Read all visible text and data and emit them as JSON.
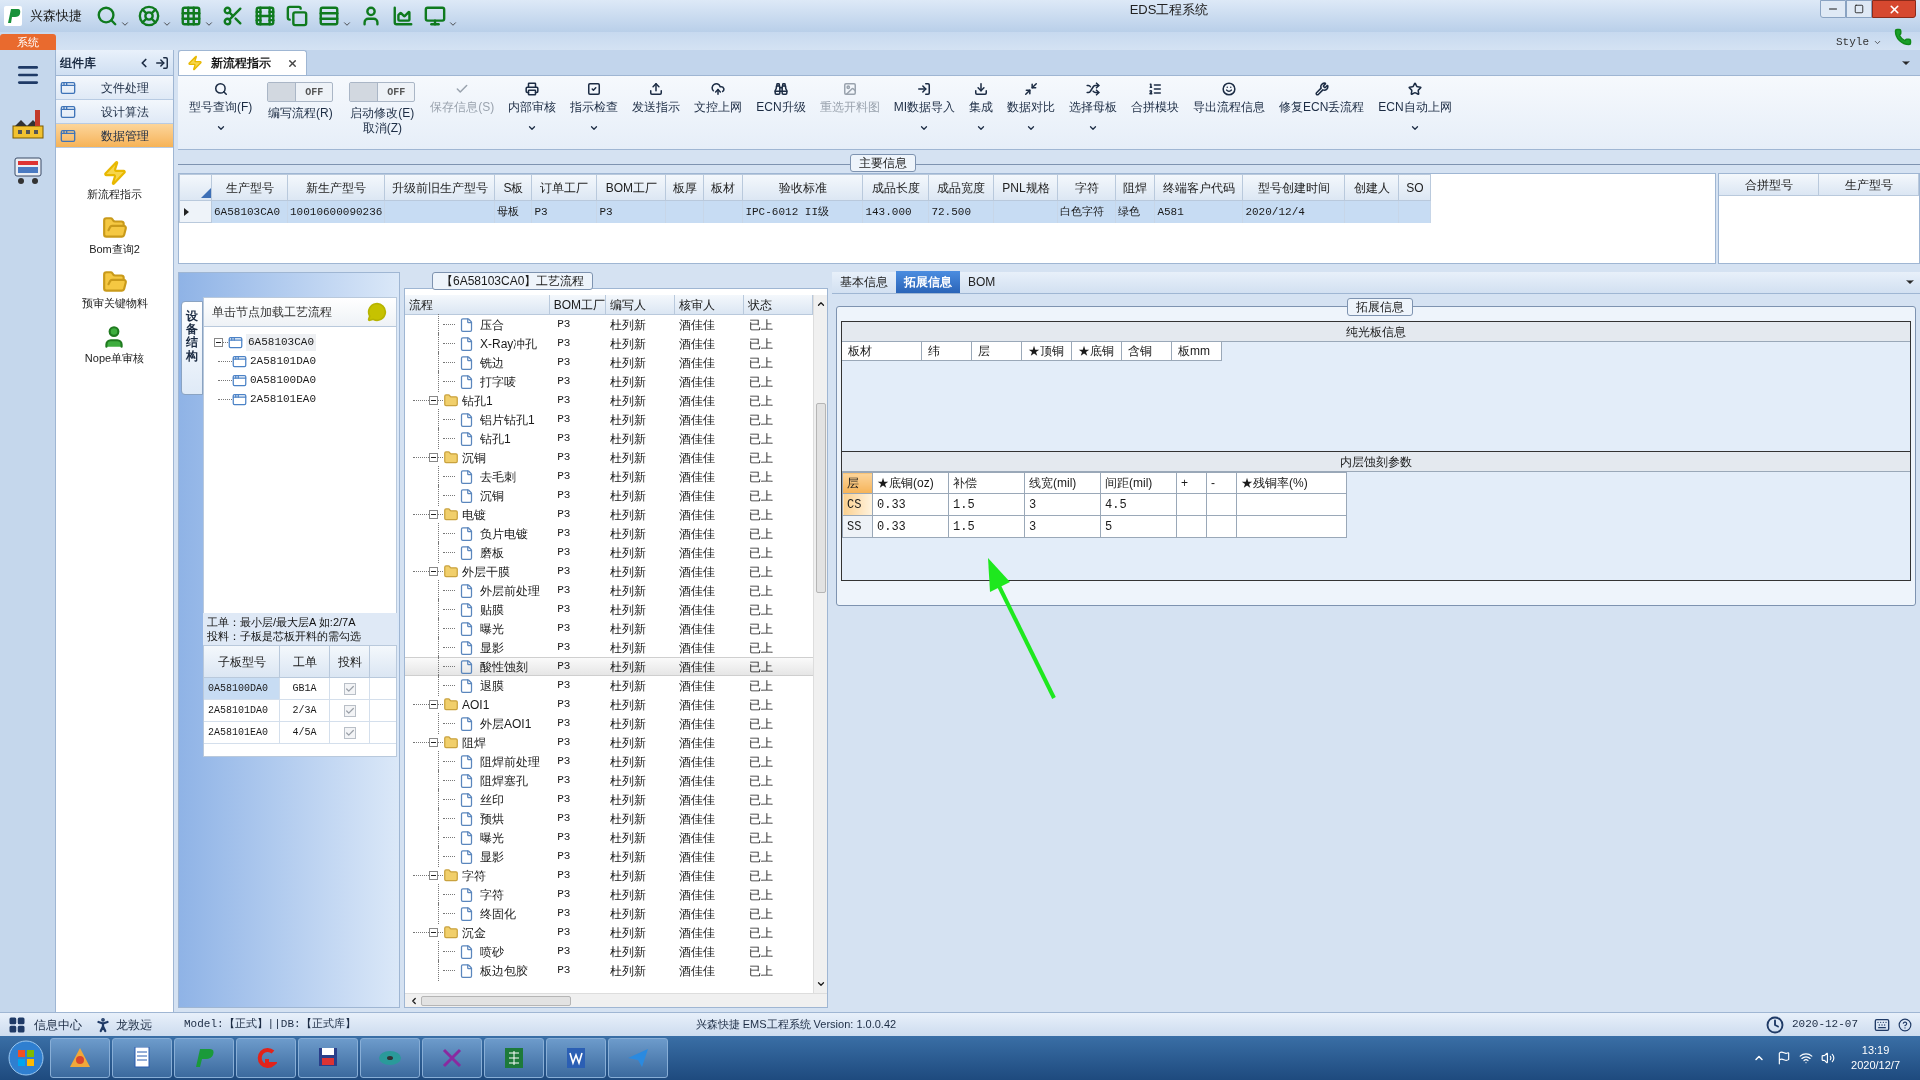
{
  "window": {
    "app_name": "兴森快捷",
    "title": "EDS工程系统"
  },
  "ribbon_tabs": [
    {
      "label": "系统",
      "selected": true
    }
  ],
  "style_menu": {
    "label": "Style"
  },
  "side_panel": {
    "title": "组件库",
    "items": [
      {
        "label": "文件处理",
        "selected": false
      },
      {
        "label": "设计算法",
        "selected": false
      },
      {
        "label": "数据管理",
        "selected": true
      }
    ],
    "launchers": [
      {
        "label": "新流程指示"
      },
      {
        "label": "Bom查询2"
      },
      {
        "label": "预审关键物料"
      },
      {
        "label": "Nope单审核"
      }
    ]
  },
  "doc_tab": {
    "label": "新流程指示",
    "selected": true
  },
  "toolbar": [
    {
      "kind": "button",
      "label": "型号查询(F)",
      "dropdown": true,
      "disabled": false
    },
    {
      "kind": "toggle",
      "label": "编写流程(R)",
      "toggle_text": "OFF",
      "on": false
    },
    {
      "kind": "toggle",
      "label": "启动修改(E)",
      "label2": "取消(Z)",
      "toggle_text": "OFF",
      "on": false
    },
    {
      "kind": "button",
      "label": "保存信息(S)",
      "dropdown": false,
      "disabled": true
    },
    {
      "kind": "button",
      "label": "内部审核",
      "dropdown": true,
      "disabled": false
    },
    {
      "kind": "button",
      "label": "指示检查",
      "dropdown": true,
      "disabled": false
    },
    {
      "kind": "button",
      "label": "发送指示",
      "dropdown": false,
      "disabled": false
    },
    {
      "kind": "button",
      "label": "文控上网",
      "dropdown": false,
      "disabled": false
    },
    {
      "kind": "button",
      "label": "ECN升级",
      "dropdown": false,
      "disabled": false
    },
    {
      "kind": "button",
      "label": "重选开料图",
      "dropdown": false,
      "disabled": true
    },
    {
      "kind": "button",
      "label": "MI数据导入",
      "dropdown": true,
      "disabled": false
    },
    {
      "kind": "button",
      "label": "集成",
      "dropdown": true,
      "disabled": false
    },
    {
      "kind": "button",
      "label": "数据对比",
      "dropdown": true,
      "disabled": false
    },
    {
      "kind": "button",
      "label": "选择母板",
      "dropdown": true,
      "disabled": false
    },
    {
      "kind": "button",
      "label": "合拼模块",
      "dropdown": false,
      "disabled": false
    },
    {
      "kind": "button",
      "label": "导出流程信息",
      "dropdown": false,
      "disabled": false
    },
    {
      "kind": "button",
      "label": "修复ECN丢流程",
      "dropdown": false,
      "disabled": false
    },
    {
      "kind": "button",
      "label": "ECN自动上网",
      "dropdown": true,
      "disabled": false
    }
  ],
  "main_info": {
    "title": "主要信息",
    "columns": [
      "生产型号",
      "新生产型号",
      "升级前旧生产型号",
      "S板",
      "订单工厂",
      "BOM工厂",
      "板厚",
      "板材",
      "验收标准",
      "成品长度",
      "成品宽度",
      "PNL规格",
      "字符",
      "阻焊",
      "终端客户代码",
      "型号创建时间",
      "创建人",
      "SO"
    ],
    "rows": [
      {
        "selected": true,
        "cells": [
          "6A58103CA0",
          "10010600090236",
          null,
          "母板",
          "P3",
          "P3",
          null,
          null,
          "IPC-6012 II级",
          "143.000",
          "72.500",
          null,
          "白色字符",
          "绿色",
          "A581",
          "2020/12/4",
          null,
          null
        ]
      }
    ]
  },
  "merge_grid": {
    "columns": [
      "合拼型号",
      "生产型号"
    ]
  },
  "structure": {
    "tab_label": "设备结构",
    "header": "单击节点加载工艺流程",
    "tree": [
      {
        "label": "6A58103CA0",
        "expanded": true,
        "children": [
          {
            "label": "2A58101DA0"
          },
          {
            "label": "0A58100DA0"
          },
          {
            "label": "2A58101EA0"
          }
        ]
      }
    ],
    "note": [
      "工单：最小层/最大层A 如:2/7A",
      "投料：子板是芯板开料的需勾选"
    ],
    "sub_boards": {
      "columns": [
        "子板型号",
        "工单",
        "投料"
      ],
      "rows": [
        {
          "model": "0A58100DA0",
          "order": "GB1A",
          "checked": true,
          "selected": true
        },
        {
          "model": "2A58101DA0",
          "order": "2/3A",
          "checked": true,
          "selected": false
        },
        {
          "model": "2A58101EA0",
          "order": "4/5A",
          "checked": true,
          "selected": false
        }
      ]
    }
  },
  "flow": {
    "title": "【6A58103CA0】工艺流程",
    "columns": [
      "流程",
      "BOM工厂",
      "编写人",
      "核审人",
      "状态"
    ],
    "groups": [
      {
        "children": [
          {
            "name": "压合",
            "cells": [
              "P3",
              "杜列新",
              "酒佳佳",
              "已上"
            ],
            "selected": false
          },
          {
            "name": "X-Ray冲孔",
            "cells": [
              "P3",
              "杜列新",
              "酒佳佳",
              "已上"
            ],
            "selected": false
          },
          {
            "name": "铣边",
            "cells": [
              "P3",
              "杜列新",
              "酒佳佳",
              "已上"
            ],
            "selected": false
          },
          {
            "name": "打字唛",
            "cells": [
              "P3",
              "杜列新",
              "酒佳佳",
              "已上"
            ],
            "selected": false
          }
        ]
      },
      {
        "name": "钻孔1",
        "cells": [
          "P3",
          "杜列新",
          "酒佳佳",
          "已上"
        ],
        "expanded": true,
        "children": [
          {
            "name": "铝片钻孔1",
            "cells": [
              "P3",
              "杜列新",
              "酒佳佳",
              "已上"
            ],
            "selected": false
          },
          {
            "name": "钻孔1",
            "cells": [
              "P3",
              "杜列新",
              "酒佳佳",
              "已上"
            ],
            "selected": false
          }
        ]
      },
      {
        "name": "沉铜",
        "cells": [
          "P3",
          "杜列新",
          "酒佳佳",
          "已上"
        ],
        "expanded": true,
        "children": [
          {
            "name": "去毛刺",
            "cells": [
              "P3",
              "杜列新",
              "酒佳佳",
              "已上"
            ],
            "selected": false
          },
          {
            "name": "沉铜",
            "cells": [
              "P3",
              "杜列新",
              "酒佳佳",
              "已上"
            ],
            "selected": false
          }
        ]
      },
      {
        "name": "电镀",
        "cells": [
          "P3",
          "杜列新",
          "酒佳佳",
          "已上"
        ],
        "expanded": true,
        "children": [
          {
            "name": "负片电镀",
            "cells": [
              "P3",
              "杜列新",
              "酒佳佳",
              "已上"
            ],
            "selected": false
          },
          {
            "name": "磨板",
            "cells": [
              "P3",
              "杜列新",
              "酒佳佳",
              "已上"
            ],
            "selected": false
          }
        ]
      },
      {
        "name": "外层干膜",
        "cells": [
          "P3",
          "杜列新",
          "酒佳佳",
          "已上"
        ],
        "expanded": true,
        "children": [
          {
            "name": "外层前处理",
            "cells": [
              "P3",
              "杜列新",
              "酒佳佳",
              "已上"
            ],
            "selected": false
          },
          {
            "name": "贴膜",
            "cells": [
              "P3",
              "杜列新",
              "酒佳佳",
              "已上"
            ],
            "selected": false
          },
          {
            "name": "曝光",
            "cells": [
              "P3",
              "杜列新",
              "酒佳佳",
              "已上"
            ],
            "selected": false
          },
          {
            "name": "显影",
            "cells": [
              "P3",
              "杜列新",
              "酒佳佳",
              "已上"
            ],
            "selected": false
          },
          {
            "name": "酸性蚀刻",
            "cells": [
              "P3",
              "杜列新",
              "酒佳佳",
              "已上"
            ],
            "selected": true
          },
          {
            "name": "退膜",
            "cells": [
              "P3",
              "杜列新",
              "酒佳佳",
              "已上"
            ],
            "selected": false
          }
        ]
      },
      {
        "name": "AOI1",
        "cells": [
          "P3",
          "杜列新",
          "酒佳佳",
          "已上"
        ],
        "expanded": true,
        "children": [
          {
            "name": "外层AOI1",
            "cells": [
              "P3",
              "杜列新",
              "酒佳佳",
              "已上"
            ],
            "selected": false
          }
        ]
      },
      {
        "name": "阻焊",
        "cells": [
          "P3",
          "杜列新",
          "酒佳佳",
          "已上"
        ],
        "expanded": true,
        "children": [
          {
            "name": "阻焊前处理",
            "cells": [
              "P3",
              "杜列新",
              "酒佳佳",
              "已上"
            ],
            "selected": false
          },
          {
            "name": "阻焊塞孔",
            "cells": [
              "P3",
              "杜列新",
              "酒佳佳",
              "已上"
            ],
            "selected": false
          },
          {
            "name": "丝印",
            "cells": [
              "P3",
              "杜列新",
              "酒佳佳",
              "已上"
            ],
            "selected": false
          },
          {
            "name": "预烘",
            "cells": [
              "P3",
              "杜列新",
              "酒佳佳",
              "已上"
            ],
            "selected": false
          },
          {
            "name": "曝光",
            "cells": [
              "P3",
              "杜列新",
              "酒佳佳",
              "已上"
            ],
            "selected": false
          },
          {
            "name": "显影",
            "cells": [
              "P3",
              "杜列新",
              "酒佳佳",
              "已上"
            ],
            "selected": false
          }
        ]
      },
      {
        "name": "字符",
        "cells": [
          "P3",
          "杜列新",
          "酒佳佳",
          "已上"
        ],
        "expanded": true,
        "children": [
          {
            "name": "字符",
            "cells": [
              "P3",
              "杜列新",
              "酒佳佳",
              "已上"
            ],
            "selected": false
          },
          {
            "name": "终固化",
            "cells": [
              "P3",
              "杜列新",
              "酒佳佳",
              "已上"
            ],
            "selected": false
          }
        ]
      },
      {
        "name": "沉金",
        "cells": [
          "P3",
          "杜列新",
          "酒佳佳",
          "已上"
        ],
        "expanded": true,
        "children": [
          {
            "name": "喷砂",
            "cells": [
              "P3",
              "杜列新",
              "酒佳佳",
              "已上"
            ],
            "selected": false
          },
          {
            "name": "板边包胶",
            "cells": [
              "P3",
              "杜列新",
              "酒佳佳",
              "已上"
            ],
            "selected": false
          }
        ]
      }
    ]
  },
  "detail_tabs": [
    {
      "label": "基本信息",
      "selected": false
    },
    {
      "label": "拓展信息",
      "selected": true
    },
    {
      "label": "BOM",
      "selected": false
    }
  ],
  "ext_info": {
    "title": "拓展信息",
    "plain_board": {
      "title": "纯光板信息",
      "columns": [
        "板材",
        "纬",
        "层",
        "★顶铜",
        "★底铜",
        "含铜",
        "板mm"
      ]
    },
    "inner_etch": {
      "title": "内层蚀刻参数",
      "columns": [
        "层",
        "★底铜(oz)",
        "补偿",
        "线宽(mil)",
        "间距(mil)",
        "+",
        "-",
        "★残铜率(%)"
      ],
      "rows": [
        {
          "selected": true,
          "cells": [
            "CS",
            "0.33",
            "1.5",
            "3",
            "4.5",
            null,
            null,
            null
          ]
        },
        {
          "selected": false,
          "cells": [
            "SS",
            "0.33",
            "1.5",
            "3",
            "5",
            null,
            null,
            null
          ]
        }
      ]
    }
  },
  "status_bar": {
    "info_center": "信息中心",
    "user": "龙敦远",
    "env": "Model:【正式】||DB:【正式库】",
    "version": "兴森快捷 EMS工程系统 Version: 1.0.0.42",
    "date": "2020-12-07"
  },
  "taskbar": {
    "time": "13:19",
    "date": "2020/12/7"
  }
}
